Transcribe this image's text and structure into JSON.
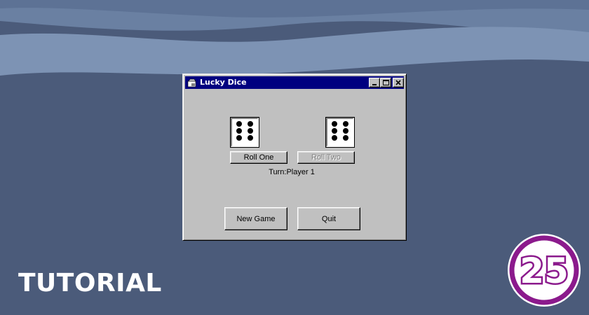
{
  "window": {
    "title": "Lucky Dice",
    "title_bar_color": "#000080",
    "face_color": "#c0c0c0"
  },
  "dice": [
    {
      "name": "die-one",
      "value": 6
    },
    {
      "name": "die-two",
      "value": 6
    }
  ],
  "buttons": {
    "roll_one": "Roll One",
    "roll_two": "Roll Two",
    "new_game": "New Game",
    "quit": "Quit"
  },
  "status": {
    "turn": "Turn:Player 1"
  },
  "overlay": {
    "tutorial": "TUTORIAL",
    "logo_text": "25",
    "logo_color": "#8b1a8c"
  },
  "icons": [
    "window-app-icon",
    "minimize-icon",
    "maximize-icon",
    "close-icon"
  ]
}
